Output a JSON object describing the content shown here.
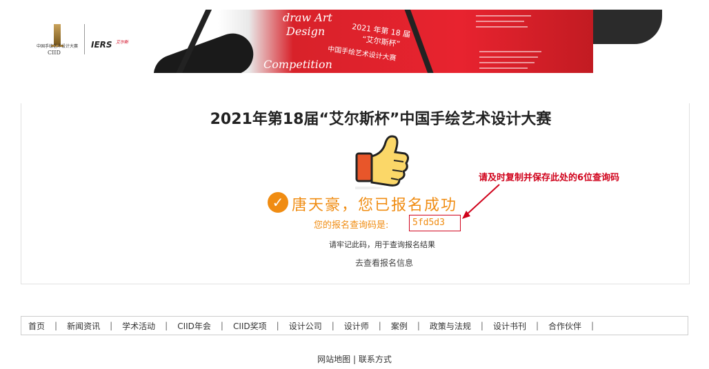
{
  "header": {
    "logo_cn": "中国手绘艺术设计大赛",
    "logo_ciid": "CIID",
    "logo_iers": "IERS",
    "logo_iers_tag": "艾尔斯",
    "banner": {
      "line1": "draw Art",
      "line2": "Design",
      "line3": "Competition",
      "cn1": "2021 年第 18 届",
      "cn2": "“艾尔斯杯”",
      "cn3": "中国手绘艺术设计大赛"
    }
  },
  "main": {
    "title": "2021年第18届“艾尔斯杯”中国手绘艺术设计大赛",
    "success_icon": "✓",
    "success_message": "唐天豪，您已报名成功",
    "code_label": "您的报名查询码是:",
    "code_value": "5fd5d3",
    "remember_text": "请牢记此码，用于查询报名结果",
    "view_info_link": "去查看报名信息",
    "annotation": "请及时复制并保存此处的6位查询码",
    "colors": {
      "accent": "#f08c12",
      "annotation": "#d0021b"
    }
  },
  "nav": {
    "items": [
      "首页",
      "新闻资讯",
      "学术活动",
      "CIID年会",
      "CIID奖项",
      "设计公司",
      "设计师",
      "案例",
      "政策与法规",
      "设计书刊",
      "合作伙伴"
    ],
    "separator": "|"
  },
  "footer": {
    "sitemap": "网站地图",
    "separator": "|",
    "contact": "联系方式"
  }
}
